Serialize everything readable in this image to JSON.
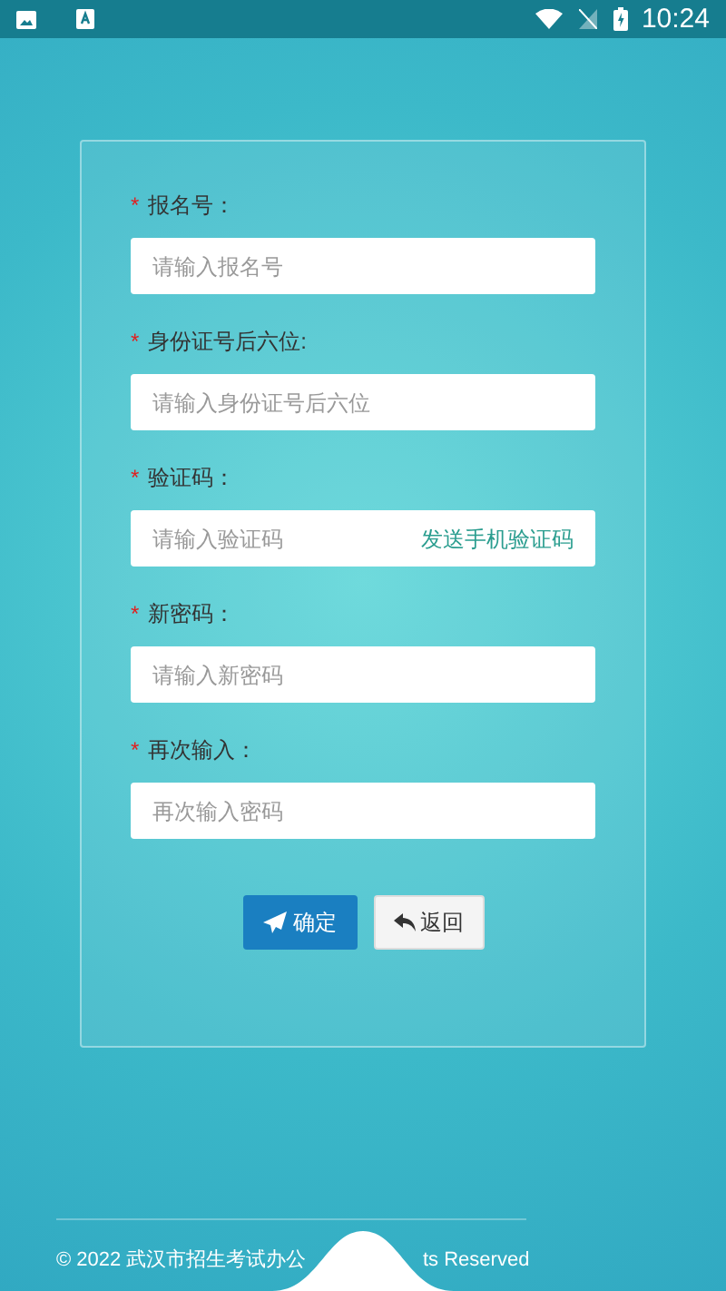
{
  "status_bar": {
    "time": "10:24"
  },
  "fields": [
    {
      "label": "报名号：",
      "required_mark": "*",
      "placeholder": "请输入报名号",
      "kind": "text"
    },
    {
      "label": "身份证号后六位:",
      "required_mark": "*",
      "placeholder": "请输入身份证号后六位",
      "kind": "text"
    },
    {
      "label": "验证码：",
      "required_mark": "*",
      "placeholder": "请输入验证码",
      "kind": "code",
      "action": "发送手机验证码"
    },
    {
      "label": "新密码：",
      "required_mark": "*",
      "placeholder": "请输入新密码",
      "kind": "password"
    },
    {
      "label": "再次输入：",
      "required_mark": "*",
      "placeholder": "再次输入密码",
      "kind": "password"
    }
  ],
  "buttons": [
    {
      "label": "确定",
      "kind": "primary"
    },
    {
      "label": "返回",
      "kind": "back"
    }
  ],
  "footer": {
    "text_before": "© 2022 武汉市招生考试办公",
    "text_after": "ts Reserved"
  }
}
